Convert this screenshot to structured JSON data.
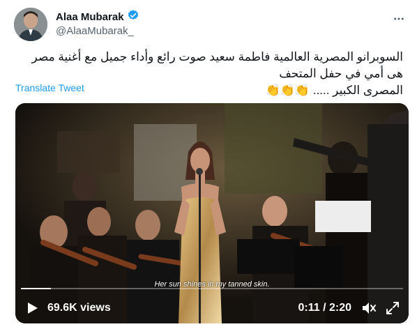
{
  "author": {
    "display_name": "Alaa Mubarak",
    "handle": "@AlaaMubarak_",
    "verified": true
  },
  "more_icon": "more-horizontal-icon",
  "tweet": {
    "text_line1": "السوبرانو المصرية العالمية فاطمة سعيد صوت رائع وأداء جميل مع أغنية مصر هى أمي في حفل المتحف",
    "text_line2": "المصرى الكبير .....",
    "emoji": "👏👏👏",
    "translate_label": "Translate Tweet"
  },
  "video": {
    "subtitle": "Her sun shines in my tanned skin.",
    "views": "69.6K views",
    "time": "0:11 / 2:20",
    "progress": 0.079,
    "icons": {
      "play": "play-icon",
      "mute": "mute-icon",
      "fullscreen": "fullscreen-icon"
    }
  },
  "colors": {
    "accent": "#1d9bf0",
    "text": "#0f1419",
    "secondary_text": "#536471",
    "verified_badge": "#1d9bf0"
  }
}
